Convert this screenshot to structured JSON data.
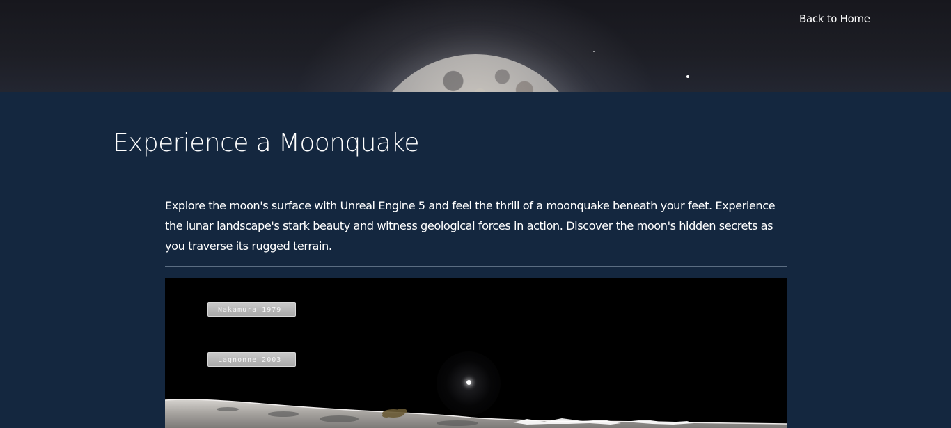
{
  "nav": {
    "back_home_label": "Back to Home"
  },
  "main": {
    "title": "Experience a Moonquake",
    "intro": "Explore the moon's surface with Unreal Engine 5 and feel the thrill of a moonquake beneath your feet. Experience the lunar landscape's stark beauty and witness geological forces in action. Discover the moon's hidden secrets as you traverse its rugged terrain."
  },
  "simulation": {
    "buttons": [
      {
        "label": "Nakamura 1979"
      },
      {
        "label": "Lagnonne 2003"
      }
    ]
  },
  "colors": {
    "page_background": "#14273f",
    "hero_background": "#1b1c22",
    "text": "#ffffff",
    "divider": "#5b6d82",
    "viewport_background": "#000000",
    "sim_button": "#b5b5b5"
  },
  "icons": {
    "moon": "moon-image",
    "sun": "sun-glow",
    "terrain": "lunar-terrain"
  }
}
